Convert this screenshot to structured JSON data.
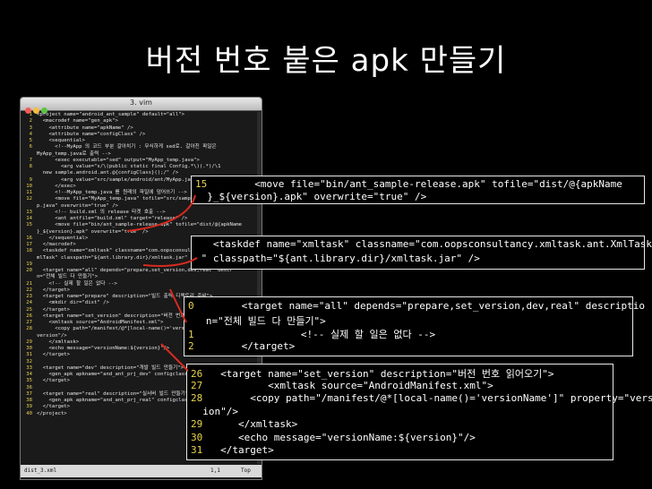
{
  "slide_title": "버전 번호 붙은 apk 만들기",
  "vim": {
    "window_title": "3. vim",
    "status_file": "dist_3.xml",
    "status_pos": "1,1",
    "status_scroll": "Top",
    "lines": [
      {
        "n": "1",
        "t": "<project name=\"android_ant_sample\" default=\"all\">"
      },
      {
        "n": "2",
        "t": "  <macrodef name=\"gen_apk\">"
      },
      {
        "n": "3",
        "t": "    <attribute name=\"apkName\" />"
      },
      {
        "n": "4",
        "t": "    <attribute name=\"configClass\" />"
      },
      {
        "n": "5",
        "t": "    <sequential>"
      },
      {
        "n": "6",
        "t": "      <!--MyApp 의 코드 부분 갈아치기 : 무식하게 sed로. 갈아친 파일은"
      },
      {
        "n": "",
        "t": "MyApp_temp.java로 출력 -->"
      },
      {
        "n": "7",
        "t": "      <exec executable=\"sed\" output=\"MyApp_temp.java\">"
      },
      {
        "n": "8",
        "t": "        <arg value=\"s/\\(public static final Config.*\\)(.*)/\\1"
      },
      {
        "n": "",
        "t": "  new sample.android.ant.@{configClass}();/\" />"
      },
      {
        "n": "9",
        "t": "        <arg value=\"src/sample/android/ant/MyApp.java\" />"
      },
      {
        "n": "10",
        "t": "      </exec>"
      },
      {
        "n": "11",
        "t": "      <!--MyApp_temp.java 를 원래의 파일에 덮어쓰기 -->"
      },
      {
        "n": "12",
        "t": "      <move file=\"MyApp_temp.java\" tofile=\"src/sample/android/ant/MyAp"
      },
      {
        "n": "",
        "t": "p.java\" overwrite=\"true\" />"
      },
      {
        "n": "13",
        "t": "      <!-- build.xml 의 release 타겟 호출 -->"
      },
      {
        "n": "14",
        "t": "      <ant antfile=\"build.xml\" target=\"release\" />"
      },
      {
        "n": "15",
        "t": "      <move file=\"bin/ant_sample-release.apk\" tofile=\"dist/@{apkName"
      },
      {
        "n": "",
        "t": "}_${version}.apk\" overwrite=\"true\" />"
      },
      {
        "n": "16",
        "t": "    </sequential>"
      },
      {
        "n": "17",
        "t": "  </macrodef>"
      },
      {
        "n": "18",
        "t": "  <taskdef name=\"xmltask\" classname=\"com.oopsconsultancy.xmltask.ant.X"
      },
      {
        "n": "",
        "t": "mlTask\" classpath=\"${ant.library.dir}/xmltask.jar\" />"
      },
      {
        "n": "19",
        "t": ""
      },
      {
        "n": "20",
        "t": "  <target name=\"all\" depends=\"prepare,set_version,dev,real\" descr"
      },
      {
        "n": "",
        "t": "n=\"전체 빌드 다 만들기\">"
      },
      {
        "n": "21",
        "t": "    <!-- 실제 할 일은 없다 -->"
      },
      {
        "n": "22",
        "t": "  </target>"
      },
      {
        "n": "23",
        "t": "  <target name=\"prepare\" description=\"빌드 출력 디렉토리 준비\">"
      },
      {
        "n": "24",
        "t": "    <mkdir dir=\"dist\" />"
      },
      {
        "n": "25",
        "t": "  </target>"
      },
      {
        "n": "26",
        "t": "  <target name=\"set_version\" description=\"버전 번호 읽어오기\">"
      },
      {
        "n": "27",
        "t": "    <xmltask source=\"AndroidManifest.xml\">"
      },
      {
        "n": "28",
        "t": "      <copy path=\"/manifest/@*[local-name()='versionName']\" property=\""
      },
      {
        "n": "",
        "t": "version\"/>"
      },
      {
        "n": "29",
        "t": "    </xmltask>"
      },
      {
        "n": "30",
        "t": "    <echo message=\"versionName:${version}\"/>"
      },
      {
        "n": "31",
        "t": "  </target>"
      },
      {
        "n": "32",
        "t": ""
      },
      {
        "n": "33",
        "t": "  <target name=\"dev\" description=\"개발 빌드 만들기\">"
      },
      {
        "n": "34",
        "t": "    <gen_apk apkname=\"and_ant_prj_dev\" configclass=\"DevConfig\" />"
      },
      {
        "n": "35",
        "t": "  </target>"
      },
      {
        "n": "36",
        "t": ""
      },
      {
        "n": "37",
        "t": "  <target name=\"real\" description=\"실서버 빌드 만들기\">"
      },
      {
        "n": "38",
        "t": "    <gen_apk apkname=\"and_ant_prj_real\" configclass=\"RealConfig\" />"
      },
      {
        "n": "39",
        "t": "  </target>"
      },
      {
        "n": "40",
        "t": "</project>"
      }
    ]
  },
  "zoom1": {
    "rows": [
      {
        "n": "15",
        "t": "        <move file=\"bin/ant_sample-release.apk\" tofile=\"dist/@{apkName"
      },
      {
        "n": "",
        "t": "  }_${version}.apk\" overwrite=\"true\" />"
      }
    ]
  },
  "zoom2": {
    "rows": [
      {
        "n": "",
        "t": "   <taskdef name=\"xmltask\" classname=\"com.oopsconsultancy.xmltask.ant.XmlTask"
      },
      {
        "n": "",
        "t": " \" classpath=\"${ant.library.dir}/xmltask.jar\" />"
      }
    ]
  },
  "zoom3": {
    "rows": [
      {
        "n": "0",
        "t": "        <target name=\"all\" depends=\"prepare,set_version,dev,real\" descriptio"
      },
      {
        "n": "",
        "t": "   n=\"전체 빌드 다 만들기\">"
      },
      {
        "n": "1",
        "t": "                  <!-- 실제 할 일은 없다 -->"
      },
      {
        "n": "2",
        "t": "        </target>"
      }
    ]
  },
  "zoom4": {
    "rows": [
      {
        "n": "26",
        "t": "   <target name=\"set_version\" description=\"버전 번호 읽어오기\">"
      },
      {
        "n": "27",
        "t": "           <xmltask source=\"AndroidManifest.xml\">"
      },
      {
        "n": "28",
        "t": "        <copy path=\"/manifest/@*[local-name()='versionName']\" property=\"vers"
      },
      {
        "n": "",
        "t": "  ion\"/>"
      },
      {
        "n": "29",
        "t": "      </xmltask>"
      },
      {
        "n": "30",
        "t": "      <echo message=\"versionName:${version}\"/>"
      },
      {
        "n": "31",
        "t": "   </target>"
      }
    ]
  },
  "colors": {
    "line_number": "#e8d44d",
    "arrow": "#d62b1f",
    "selection": "#3f74c8"
  }
}
